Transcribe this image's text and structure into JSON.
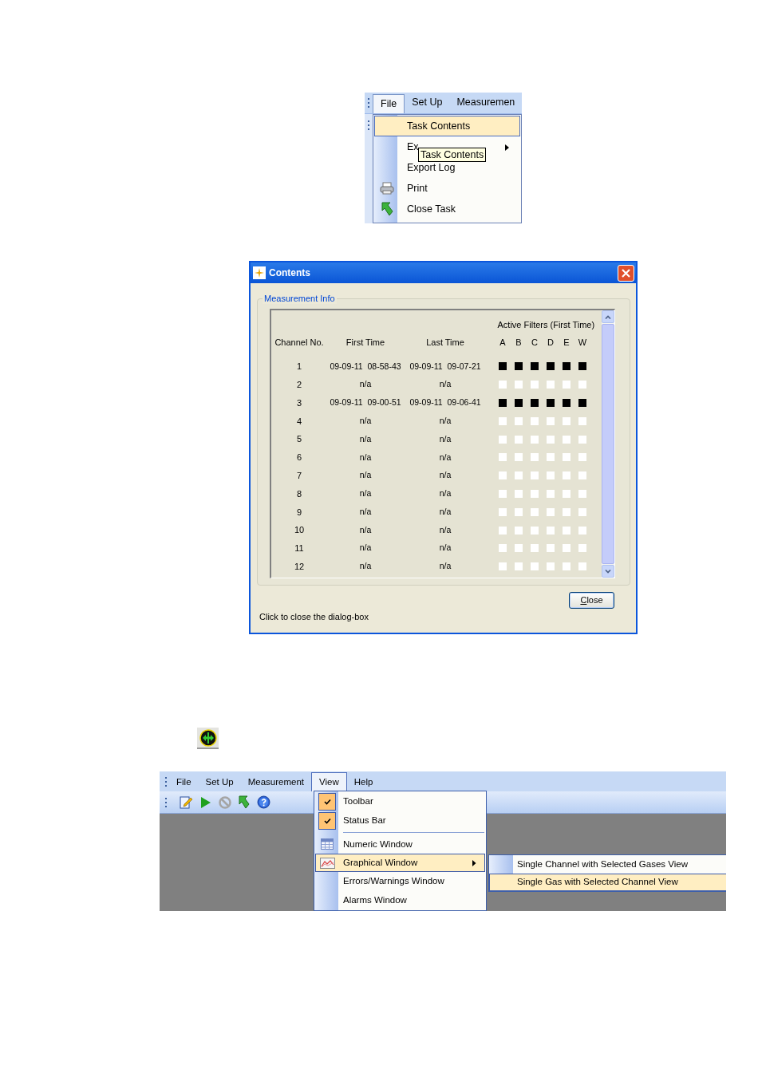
{
  "file_menu_figure": {
    "menubar": [
      {
        "label": "File",
        "selected": true
      },
      {
        "label": "Set Up",
        "selected": false
      },
      {
        "label": "Measuremen",
        "selected": false
      }
    ],
    "menu_items": [
      {
        "label": "Task Contents",
        "kind": "plain",
        "selected": true
      },
      {
        "label": "Ex",
        "kind": "submenu",
        "selected": false
      },
      {
        "label": "Export Log",
        "kind": "plain",
        "selected": false
      },
      {
        "label": "Print",
        "kind": "print",
        "selected": false
      },
      {
        "label": "Close Task",
        "kind": "close",
        "selected": false
      }
    ],
    "tooltip": "Task Contents"
  },
  "contents_dialog": {
    "title": "Contents",
    "group_label": "Measurement Info",
    "filter_header": "Active Filters (First Time)",
    "columns": [
      "Channel No.",
      "First Time",
      "Last Time"
    ],
    "filter_columns": [
      "A",
      "B",
      "C",
      "D",
      "E",
      "W"
    ],
    "rows": [
      {
        "channel": "1",
        "first_time": "09-09-11  08-58-43",
        "last_time": "09-09-11  09-07-21",
        "filters": [
          true,
          true,
          true,
          true,
          true,
          true
        ]
      },
      {
        "channel": "2",
        "first_time": "n/a",
        "last_time": "n/a",
        "filters": [
          false,
          false,
          false,
          false,
          false,
          false
        ]
      },
      {
        "channel": "3",
        "first_time": "09-09-11  09-00-51",
        "last_time": "09-09-11  09-06-41",
        "filters": [
          true,
          true,
          true,
          true,
          true,
          true
        ]
      },
      {
        "channel": "4",
        "first_time": "n/a",
        "last_time": "n/a",
        "filters": [
          false,
          false,
          false,
          false,
          false,
          false
        ]
      },
      {
        "channel": "5",
        "first_time": "n/a",
        "last_time": "n/a",
        "filters": [
          false,
          false,
          false,
          false,
          false,
          false
        ]
      },
      {
        "channel": "6",
        "first_time": "n/a",
        "last_time": "n/a",
        "filters": [
          false,
          false,
          false,
          false,
          false,
          false
        ]
      },
      {
        "channel": "7",
        "first_time": "n/a",
        "last_time": "n/a",
        "filters": [
          false,
          false,
          false,
          false,
          false,
          false
        ]
      },
      {
        "channel": "8",
        "first_time": "n/a",
        "last_time": "n/a",
        "filters": [
          false,
          false,
          false,
          false,
          false,
          false
        ]
      },
      {
        "channel": "9",
        "first_time": "n/a",
        "last_time": "n/a",
        "filters": [
          false,
          false,
          false,
          false,
          false,
          false
        ]
      },
      {
        "channel": "10",
        "first_time": "n/a",
        "last_time": "n/a",
        "filters": [
          false,
          false,
          false,
          false,
          false,
          false
        ]
      },
      {
        "channel": "11",
        "first_time": "n/a",
        "last_time": "n/a",
        "filters": [
          false,
          false,
          false,
          false,
          false,
          false
        ]
      },
      {
        "channel": "12",
        "first_time": "n/a",
        "last_time": "n/a",
        "filters": [
          false,
          false,
          false,
          false,
          false,
          false
        ]
      }
    ],
    "close_button": "Close",
    "status_text": "Click to close the dialog-box"
  },
  "view_menu_figure": {
    "menubar": [
      {
        "label": "File",
        "selected": false
      },
      {
        "label": "Set Up",
        "selected": false
      },
      {
        "label": "Measurement",
        "selected": false
      },
      {
        "label": "View",
        "selected": true
      },
      {
        "label": "Help",
        "selected": false
      }
    ],
    "view_menu": [
      {
        "kind": "check",
        "label": "Toolbar",
        "checked": true,
        "selected": false
      },
      {
        "kind": "check",
        "label": "Status Bar",
        "checked": true,
        "selected": false
      },
      {
        "kind": "separator"
      },
      {
        "kind": "table",
        "label": "Numeric Window",
        "selected": false
      },
      {
        "kind": "chart",
        "label": "Graphical Window",
        "selected": true,
        "submenu": true
      },
      {
        "kind": "plain",
        "label": "Errors/Warnings Window",
        "selected": false
      },
      {
        "kind": "plain",
        "label": "Alarms Window",
        "selected": false
      }
    ],
    "graphical_submenu": [
      {
        "label": "Single Channel with Selected Gases View",
        "selected": false
      },
      {
        "label": "Single Gas with Selected Channel View",
        "selected": true
      }
    ]
  }
}
